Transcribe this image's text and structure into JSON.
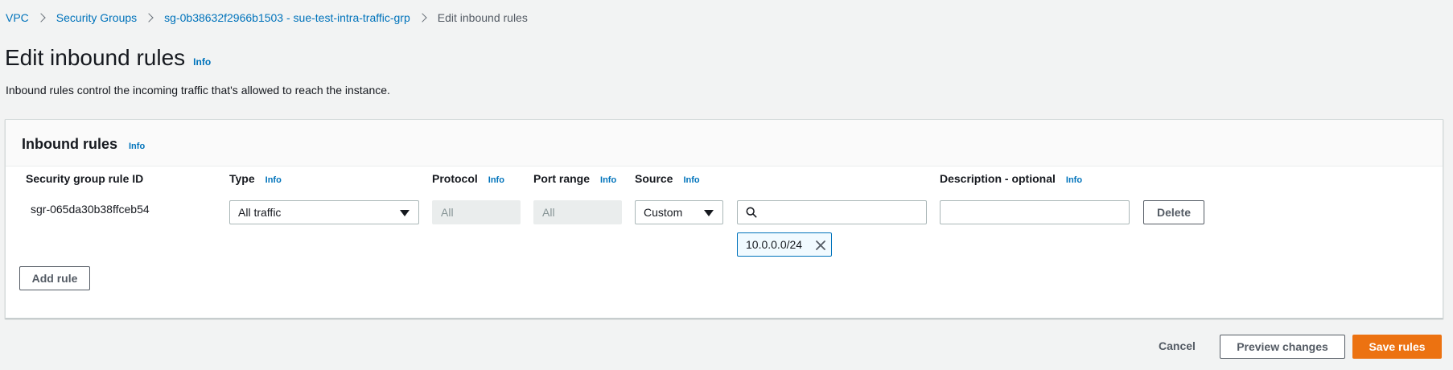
{
  "breadcrumb": {
    "items": [
      "VPC",
      "Security Groups",
      "sg-0b38632f2966b1503 - sue-test-intra-traffic-grp"
    ],
    "current": "Edit inbound rules"
  },
  "page": {
    "title": "Edit inbound rules",
    "title_info": "Info",
    "description": "Inbound rules control the incoming traffic that's allowed to reach the instance."
  },
  "panel": {
    "title": "Inbound rules",
    "info": "Info",
    "columns": {
      "rule_id": "Security group rule ID",
      "type": "Type",
      "protocol": "Protocol",
      "port_range": "Port range",
      "source": "Source",
      "description": "Description - optional"
    },
    "info_label": "Info",
    "rule": {
      "id": "sgr-065da30b38ffceb54",
      "type": "All traffic",
      "protocol": "All",
      "port_range": "All",
      "source_type": "Custom",
      "source_search_value": "",
      "source_token": "10.0.0.0/24",
      "description_value": "",
      "delete_label": "Delete"
    },
    "add_rule_label": "Add rule"
  },
  "footer": {
    "cancel_label": "Cancel",
    "preview_label": "Preview changes",
    "save_label": "Save rules"
  },
  "colors": {
    "link": "#0073bb",
    "primary": "#ec7211",
    "background": "#f2f3f3"
  },
  "icons": [
    "chevron-right-icon",
    "caret-down-icon",
    "search-icon",
    "close-icon"
  ]
}
